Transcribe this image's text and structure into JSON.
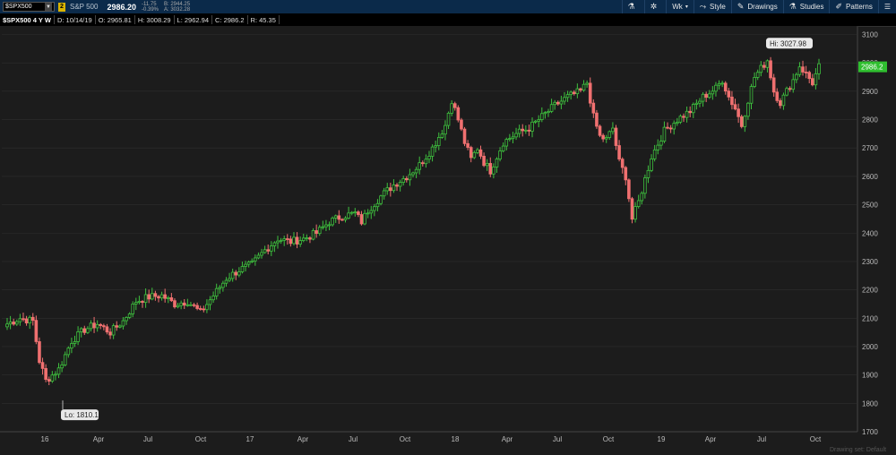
{
  "header": {
    "symbol": "$SPX500",
    "symbol_dropdown": "▼",
    "badge": "2",
    "name": "S&P 500",
    "last": "2986.20",
    "change": "-11.75",
    "change_pct": "-0.39%",
    "bid": "B: 2944.25",
    "ask": "A: 3032.28"
  },
  "toolbar": {
    "flask_icon": "flask-icon",
    "gear_icon": "gear-icon",
    "timeframe": "Wk",
    "style": "Style",
    "drawings": "Drawings",
    "studies": "Studies",
    "patterns": "Patterns"
  },
  "info": {
    "title": "$SPX500 4 Y W",
    "date": "D: 10/14/19",
    "open": "O: 2965.81",
    "high": "H: 3008.29",
    "low": "L: 2962.94",
    "close": "C: 2986.2",
    "range": "R: 45.35"
  },
  "colors": {
    "up": "#3ec13e",
    "down": "#f07070",
    "background": "#1c1c1c",
    "grid": "#2e2e2e",
    "price_badge": "#2fbf2f"
  },
  "chart_data": {
    "type": "candlestick",
    "ylim": [
      1700,
      3130
    ],
    "y_ticks": [
      1700,
      1800,
      1900,
      2000,
      2100,
      2200,
      2300,
      2400,
      2500,
      2600,
      2700,
      2800,
      2900,
      3000,
      3100
    ],
    "x_ticks": [
      "16",
      "Apr",
      "Jul",
      "Oct",
      "17",
      "Apr",
      "Jul",
      "Oct",
      "18",
      "Apr",
      "Jul",
      "Oct",
      "19",
      "Apr",
      "Jul",
      "Oct"
    ],
    "annotations": {
      "high": "Hi: 3027.98",
      "low": "Lo: 1810.1",
      "last": "2986.2"
    },
    "footer_label": "Drawing set: Default",
    "anchors": [
      [
        0,
        2080
      ],
      [
        4,
        2100
      ],
      [
        8,
        2090
      ],
      [
        10,
        1950
      ],
      [
        12,
        1880
      ],
      [
        14,
        1900
      ],
      [
        16,
        1920
      ],
      [
        20,
        2020
      ],
      [
        24,
        2060
      ],
      [
        28,
        2080
      ],
      [
        32,
        2050
      ],
      [
        36,
        2090
      ],
      [
        40,
        2160
      ],
      [
        44,
        2175
      ],
      [
        48,
        2180
      ],
      [
        52,
        2150
      ],
      [
        56,
        2160
      ],
      [
        58,
        2140
      ],
      [
        60,
        2120
      ],
      [
        64,
        2180
      ],
      [
        68,
        2240
      ],
      [
        72,
        2270
      ],
      [
        76,
        2290
      ],
      [
        80,
        2340
      ],
      [
        84,
        2380
      ],
      [
        88,
        2370
      ],
      [
        92,
        2380
      ],
      [
        96,
        2400
      ],
      [
        100,
        2440
      ],
      [
        104,
        2460
      ],
      [
        108,
        2470
      ],
      [
        110,
        2440
      ],
      [
        112,
        2480
      ],
      [
        116,
        2530
      ],
      [
        120,
        2570
      ],
      [
        124,
        2600
      ],
      [
        128,
        2640
      ],
      [
        132,
        2700
      ],
      [
        136,
        2780
      ],
      [
        138,
        2870
      ],
      [
        140,
        2800
      ],
      [
        142,
        2720
      ],
      [
        144,
        2660
      ],
      [
        146,
        2700
      ],
      [
        148,
        2650
      ],
      [
        150,
        2620
      ],
      [
        152,
        2670
      ],
      [
        154,
        2720
      ],
      [
        158,
        2750
      ],
      [
        162,
        2770
      ],
      [
        166,
        2810
      ],
      [
        170,
        2850
      ],
      [
        174,
        2880
      ],
      [
        178,
        2900
      ],
      [
        180,
        2930
      ],
      [
        182,
        2810
      ],
      [
        184,
        2740
      ],
      [
        186,
        2730
      ],
      [
        188,
        2770
      ],
      [
        190,
        2650
      ],
      [
        192,
        2600
      ],
      [
        194,
        2450
      ],
      [
        196,
        2510
      ],
      [
        198,
        2590
      ],
      [
        200,
        2670
      ],
      [
        204,
        2760
      ],
      [
        208,
        2800
      ],
      [
        212,
        2830
      ],
      [
        216,
        2880
      ],
      [
        220,
        2910
      ],
      [
        222,
        2940
      ],
      [
        224,
        2880
      ],
      [
        226,
        2840
      ],
      [
        228,
        2780
      ],
      [
        230,
        2870
      ],
      [
        232,
        2950
      ],
      [
        234,
        2980
      ],
      [
        236,
        3010
      ],
      [
        238,
        2900
      ],
      [
        240,
        2860
      ],
      [
        242,
        2900
      ],
      [
        244,
        2940
      ],
      [
        246,
        2990
      ],
      [
        248,
        2960
      ],
      [
        250,
        2930
      ],
      [
        252,
        2986
      ]
    ]
  }
}
